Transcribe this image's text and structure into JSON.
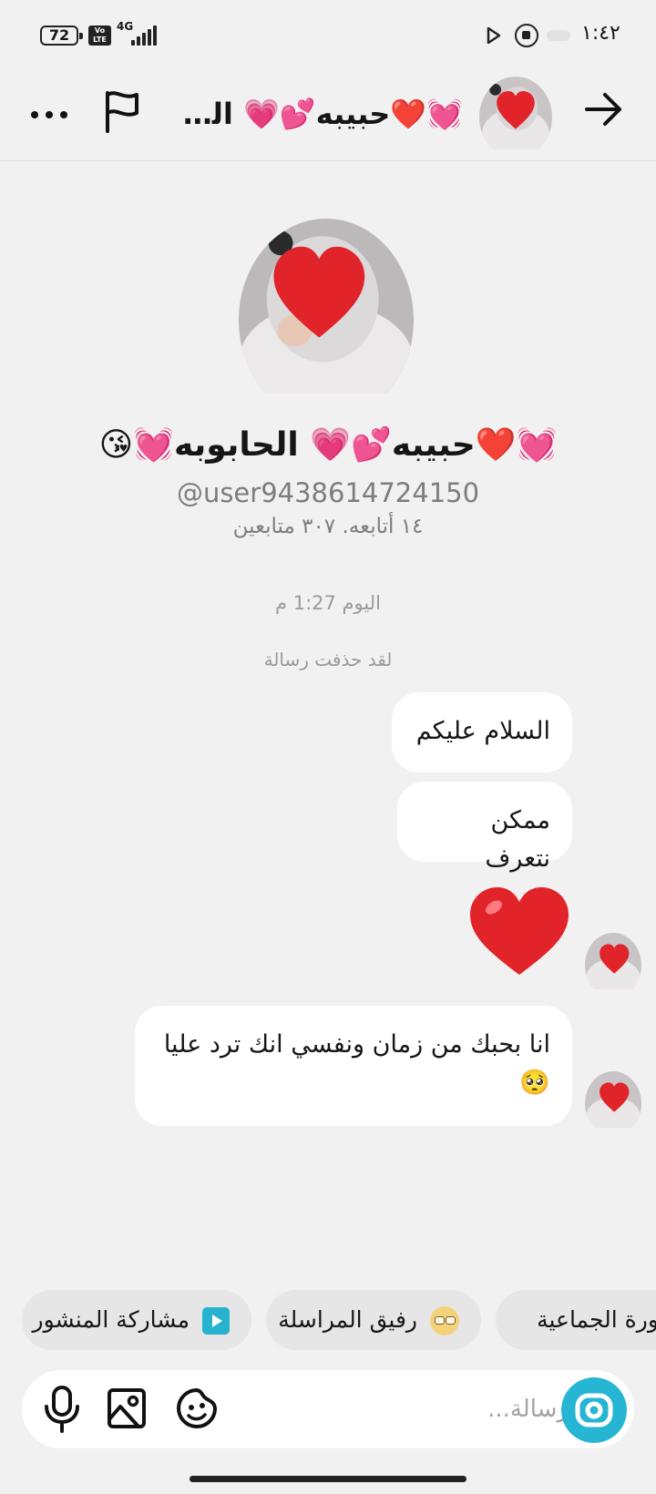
{
  "status_bar": {
    "battery": "72",
    "volte": "Vo LTE",
    "network": "4G",
    "time": "١:٤٢"
  },
  "header": {
    "display_name": "💓❤️حبيبه💕💗 الحابوبه💓😘",
    "more_icon": "more-horizontal-icon",
    "flag_icon": "flag-icon",
    "back_icon": "arrow-right-icon"
  },
  "profile": {
    "name": "💓❤️حبيبه💕💗 الحابوبه💓😘",
    "username": "@user9438614724150",
    "stats": "١٤ أتابعه. ٣٠٧ متابعين"
  },
  "conversation": {
    "timestamp": "اليوم 1:27 م",
    "deleted_notice": "لقد حذفت رسالة",
    "messages": [
      {
        "text": "السلام عليكم"
      },
      {
        "text": "ممكن نتعرف"
      },
      {
        "emoji": "red-heart"
      },
      {
        "text": "انا بحبك من زمان ونفسي انك ترد عليا 🥺"
      }
    ]
  },
  "chips": [
    {
      "label": "مشاركة المنشور",
      "icon": "play-icon"
    },
    {
      "label": "رفيق المراسلة",
      "icon": "glasses-emoji-icon"
    },
    {
      "label": "الصورة الجماعية",
      "icon": ""
    }
  ],
  "composer": {
    "placeholder": "رسالة...",
    "value": ""
  },
  "colors": {
    "background": "#f1f1f2",
    "accent": "#26b5d3",
    "bubble": "#ffffff",
    "heart": "#e0242a"
  }
}
